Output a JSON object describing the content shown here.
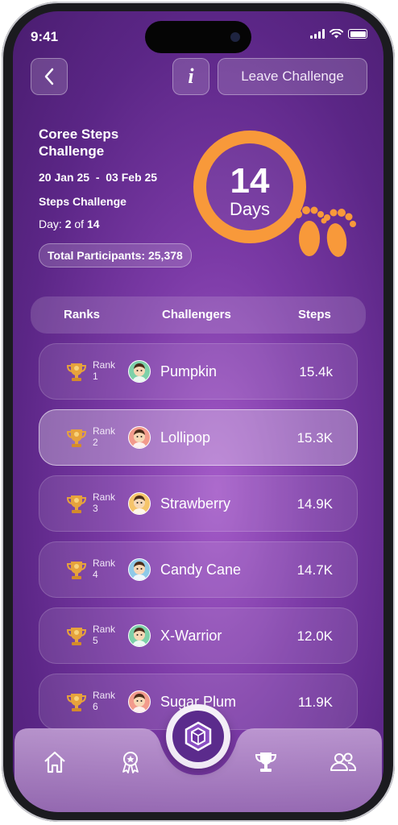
{
  "status_bar": {
    "time": "9:41"
  },
  "header": {
    "back_icon": "chevron-left-icon",
    "info_icon": "info-icon",
    "info_label": "i",
    "leave_label": "Leave Challenge"
  },
  "challenge": {
    "title": "Coree Steps Challenge",
    "dates": "20 Jan 25  -  03 Feb 25",
    "type": "Steps Challenge",
    "day_label": "Day:",
    "day_current": "2",
    "day_of": "of",
    "day_total": "14",
    "participants": "Total Participants: 25,378",
    "duration_number": "14",
    "duration_unit": "Days",
    "ring_progress": 1.0
  },
  "leaderboard": {
    "columns": [
      "Ranks",
      "Challengers",
      "Steps"
    ],
    "rows": [
      {
        "rank_label": "Rank",
        "rank": "1",
        "name": "Pumpkin",
        "steps": "15.4k",
        "highlighted": false
      },
      {
        "rank_label": "Rank",
        "rank": "2",
        "name": "Lollipop",
        "steps": "15.3K",
        "highlighted": true
      },
      {
        "rank_label": "Rank",
        "rank": "3",
        "name": "Strawberry",
        "steps": "14.9K",
        "highlighted": false
      },
      {
        "rank_label": "Rank",
        "rank": "4",
        "name": "Candy Cane",
        "steps": "14.7K",
        "highlighted": false
      },
      {
        "rank_label": "Rank",
        "rank": "5",
        "name": "X-Warrior",
        "steps": "12.0K",
        "highlighted": false
      },
      {
        "rank_label": "Rank",
        "rank": "6",
        "name": "Sugar Plum",
        "steps": "11.9K",
        "highlighted": false
      }
    ]
  },
  "bottom_nav": {
    "items": [
      "home-icon",
      "award-icon",
      "brand-logo",
      "trophy-icon",
      "people-icon"
    ]
  },
  "colors": {
    "accent": "#f8993a",
    "background": "#6e2f9c",
    "trophy": "#e6a23c"
  }
}
